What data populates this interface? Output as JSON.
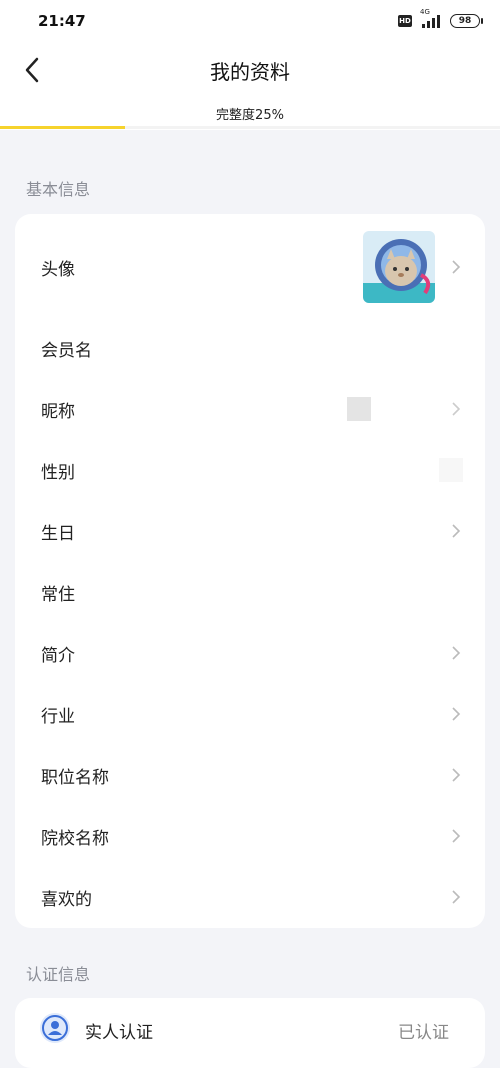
{
  "status_bar": {
    "time": "21:47",
    "hd_label": "HD",
    "network_label": "4G",
    "battery": "98"
  },
  "header": {
    "back_icon": "chevron-left-icon",
    "title": "我的资料",
    "completeness_label": "完整度25%",
    "completeness_value": 0.25,
    "accent_color": "#f6d32d"
  },
  "basic_info": {
    "section_title": "基本信息",
    "rows": [
      {
        "label": "头像",
        "has_chevron": true,
        "value_type": "avatar"
      },
      {
        "label": "会员名",
        "has_chevron": false
      },
      {
        "label": "昵称",
        "has_chevron": true
      },
      {
        "label": "性别",
        "has_chevron": false
      },
      {
        "label": "生日",
        "has_chevron": true
      },
      {
        "label": "常住",
        "has_chevron": false
      },
      {
        "label": "简介",
        "has_chevron": true
      },
      {
        "label": "行业",
        "has_chevron": true
      },
      {
        "label": "职位名称",
        "has_chevron": true
      },
      {
        "label": "院校名称",
        "has_chevron": true
      },
      {
        "label": "喜欢的",
        "has_chevron": true
      }
    ]
  },
  "auth_info": {
    "section_title": "认证信息",
    "rows": [
      {
        "label": "实人认证",
        "status": "已认证",
        "icon": "user-shield-icon"
      }
    ]
  }
}
